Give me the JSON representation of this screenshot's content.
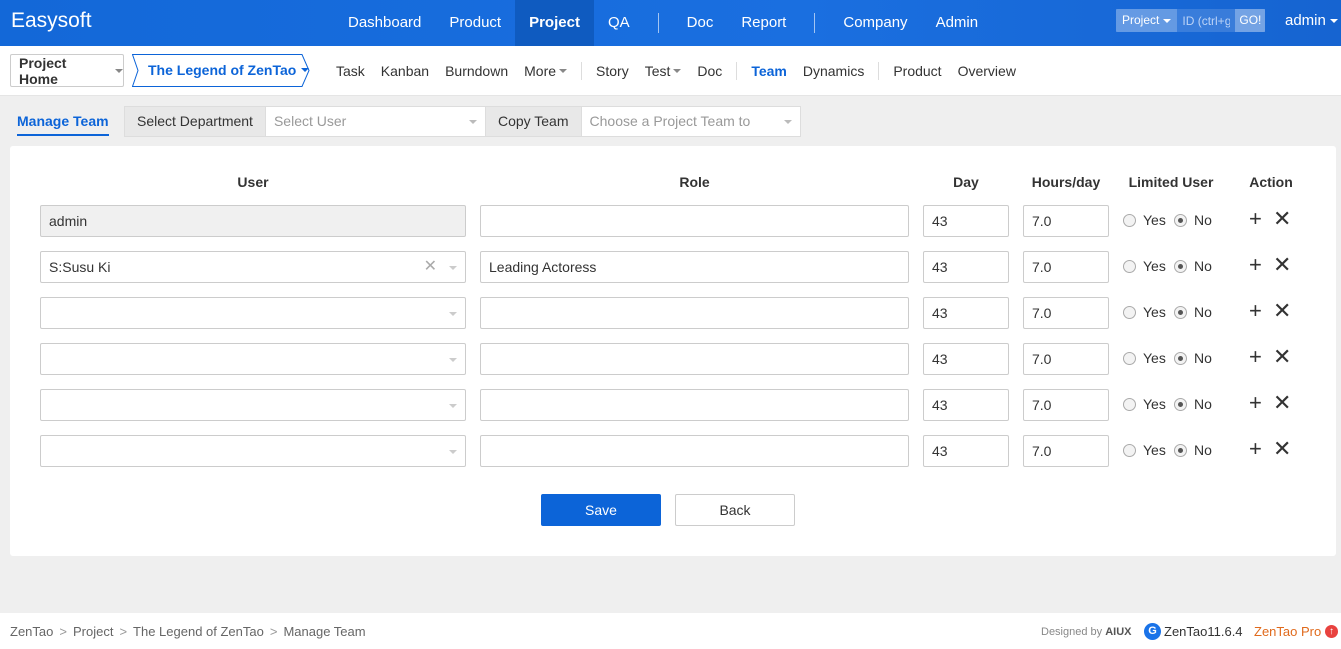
{
  "header": {
    "brand": "Easysoft",
    "nav": [
      "Dashboard",
      "Product",
      "Project",
      "QA",
      "Doc",
      "Report",
      "Company",
      "Admin"
    ],
    "search_type": "Project",
    "search_placeholder": "ID (ctrl+g",
    "search_go": "GO!",
    "user": "admin"
  },
  "subnav": {
    "home": "Project Home",
    "project": "The Legend of ZenTao",
    "items": [
      "Task",
      "Kanban",
      "Burndown",
      "More",
      "Story",
      "Test",
      "Doc",
      "Team",
      "Dynamics",
      "Product",
      "Overview"
    ]
  },
  "toolbar": {
    "tab": "Manage Team",
    "dept_label": "Select Department",
    "user_placeholder": "Select User",
    "copy_label": "Copy Team",
    "copy_placeholder": "Choose a Project Team to"
  },
  "table": {
    "headers": [
      "User",
      "Role",
      "Day",
      "Hours/day",
      "Limited User",
      "Action"
    ],
    "yes": "Yes",
    "no": "No",
    "rows": [
      {
        "user": "admin",
        "role": "",
        "day": "43",
        "hours": "7.0"
      },
      {
        "user": "S:Susu Ki",
        "role": "Leading Actoress",
        "day": "43",
        "hours": "7.0"
      },
      {
        "user": "",
        "role": "",
        "day": "43",
        "hours": "7.0"
      },
      {
        "user": "",
        "role": "",
        "day": "43",
        "hours": "7.0"
      },
      {
        "user": "",
        "role": "",
        "day": "43",
        "hours": "7.0"
      },
      {
        "user": "",
        "role": "",
        "day": "43",
        "hours": "7.0"
      }
    ]
  },
  "buttons": {
    "save": "Save",
    "back": "Back"
  },
  "footer": {
    "crumbs": [
      "ZenTao",
      "Project",
      "The Legend of ZenTao",
      "Manage Team"
    ],
    "designed_by": "Designed by",
    "designer": "AIUX",
    "version": "ZenTao11.6.4",
    "pro": "ZenTao Pro"
  }
}
